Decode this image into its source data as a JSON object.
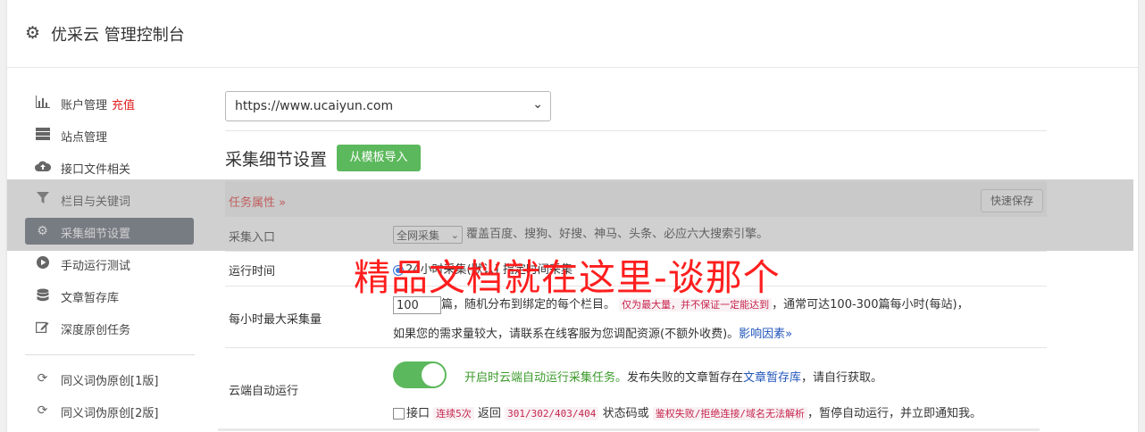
{
  "header": {
    "title": "优采云 管理控制台",
    "icon": "gear-icon"
  },
  "sidebar": {
    "items": [
      {
        "label": "账户管理",
        "extra": "充值",
        "icon": "bar-chart-icon"
      },
      {
        "label": "站点管理",
        "icon": "server-icon"
      },
      {
        "label": "接口文件相关",
        "icon": "cloud-upload-icon"
      },
      {
        "label": "栏目与关键词",
        "icon": "filter-icon"
      },
      {
        "label": "采集细节设置",
        "icon": "gears-icon",
        "active": true
      },
      {
        "label": "手动运行测试",
        "icon": "play-circle-icon"
      },
      {
        "label": "文章暂存库",
        "icon": "database-icon"
      },
      {
        "label": "深度原创任务",
        "icon": "edit-icon"
      },
      {
        "label": "同义词伪原创[1版]",
        "icon": "refresh-icon"
      },
      {
        "label": "同义词伪原创[2版]",
        "icon": "refresh-icon"
      }
    ]
  },
  "main": {
    "site_select": "https://www.ucaiyun.com",
    "section_title": "采集细节设置",
    "import_button": "从模板导入",
    "task_props": "任务属性 »",
    "quick_save": "快速保存",
    "rows": {
      "entry": {
        "label": "采集入口",
        "select": "全网采集",
        "desc": "覆盖百度、搜狗、好搜、神马、头条、必应六大搜索引擎。"
      },
      "runtime": {
        "label": "运行时间",
        "text": "24小时采集(默认)  指定时间采集"
      },
      "max": {
        "label": "每小时最大采集量",
        "value": "100",
        "t1": "篇，随机分布到绑定的每个栏目。",
        "code1": "仅为最大量，并不保证一定能达到",
        "t2": "，通常可达100-300篇每小时(每站)，",
        "t3": "如果您的需求量较大，请联系在线客服为您调配资源(不额外收费)。",
        "link": "影响因素»"
      },
      "cloud": {
        "label": "云端自动运行",
        "toggle_on": true,
        "green": "开启时云端自动运行采集任务。",
        "t1": "发布失败的文章暂存在",
        "link": "文章暂存库",
        "t2": "，请自行获取。",
        "c_label": "接口",
        "code1": "连续5次",
        "t3": "返回",
        "code2": "301/302/403/404",
        "t4": "状态码或",
        "code3": "鉴权失败/拒绝连接/域名无法解析",
        "t5": "，暂停自动运行，并立即通知我。"
      }
    }
  },
  "watermark": "精品文档就在这里-谈那个"
}
